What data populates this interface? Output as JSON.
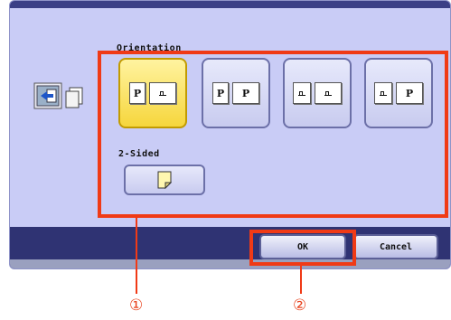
{
  "colors": {
    "panel_bg": "#c9ccf6",
    "footer_bar": "#2f3373",
    "selected_button": "#f6d63c",
    "highlight_red": "#f03a16"
  },
  "orientation_section": {
    "label": "Orientation",
    "options": [
      {
        "name": "portrait-to-landscape",
        "left_glyph": "P",
        "right_glyph": "landscape",
        "selected": true
      },
      {
        "name": "portrait-to-portrait",
        "left_glyph": "P",
        "right_glyph": "P",
        "selected": false
      },
      {
        "name": "landscape-to-landscape",
        "left_glyph": "landscape",
        "right_glyph": "landscape",
        "selected": false
      },
      {
        "name": "landscape-to-portrait",
        "left_glyph": "landscape",
        "right_glyph": "P",
        "selected": false
      }
    ],
    "glyph_p": "P"
  },
  "two_sided_section": {
    "label": "2-Sided",
    "icon": "folded-page-icon"
  },
  "footer": {
    "ok_label": "OK",
    "cancel_label": "Cancel"
  },
  "callouts": {
    "marker_1": "①",
    "marker_2": "②"
  }
}
